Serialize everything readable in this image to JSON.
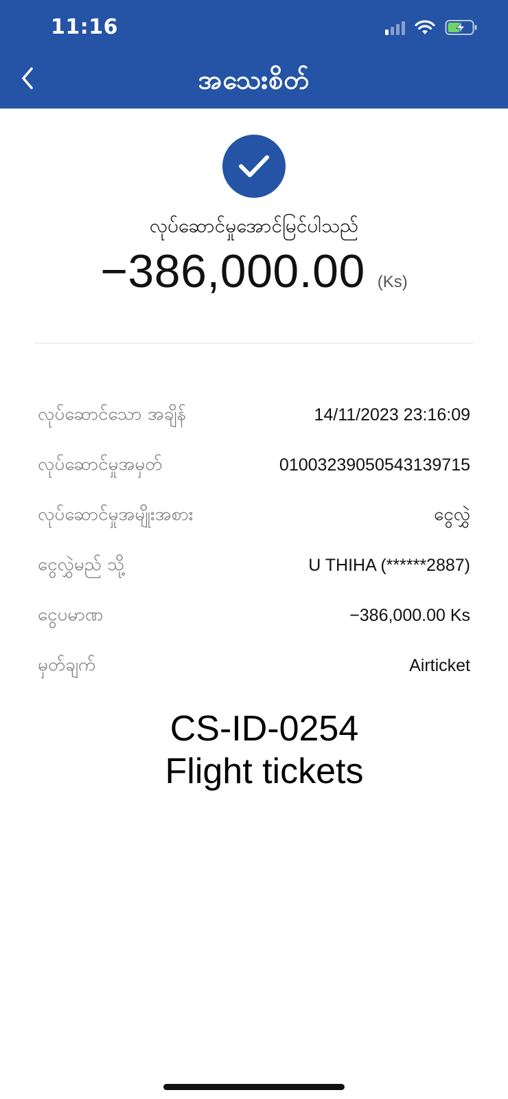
{
  "status_bar": {
    "time": "11:16"
  },
  "header": {
    "title": "အသေးစိတ်",
    "back_icon": "chevron-left-icon"
  },
  "result": {
    "icon": "checkmark-icon",
    "status_text": "လုပ်ဆောင်မှုအောင်မြင်ပါသည်",
    "amount": "−386,000.00",
    "currency": "(Ks)"
  },
  "details": [
    {
      "label": "လုပ်ဆောင်သော အချိန်",
      "value": "14/11/2023 23:16:09"
    },
    {
      "label": "လုပ်ဆောင်မှုအမှတ်",
      "value": "01003239050543139715"
    },
    {
      "label": "လုပ်ဆောင်မှုအမျိုးအစား",
      "value": "ငွေလွှဲ"
    },
    {
      "label": "ငွေလွှဲမည် သို့",
      "value": "U THIHA (******2887)"
    },
    {
      "label": "ငွေပမာဏ",
      "value": "−386,000.00 Ks"
    },
    {
      "label": "မှတ်ချက်",
      "value": "Airticket"
    }
  ],
  "overlay": {
    "line1": "CS-ID-0254",
    "line2": "Flight tickets"
  },
  "colors": {
    "brand": "#2553a5"
  }
}
